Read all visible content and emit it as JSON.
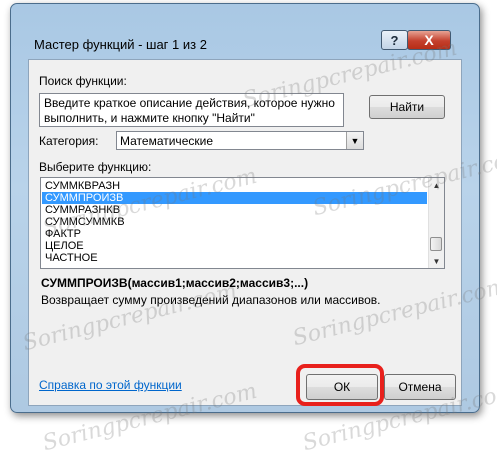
{
  "window": {
    "title": "Мастер функций - шаг 1 из 2",
    "help_button": "?",
    "close_button": "X"
  },
  "search": {
    "label": "Поиск функции:",
    "description_line1": "Введите краткое описание действия, которое нужно",
    "description_line2": "выполнить, и нажмите кнопку \"Найти\"",
    "find_button": "Найти"
  },
  "category": {
    "label": "Категория:",
    "selected": "Математические"
  },
  "functions": {
    "label": "Выберите функцию:",
    "items": [
      "СУММКВРАЗН",
      "СУММПРОИЗВ",
      "СУММРАЗНКВ",
      "СУММСУММКВ",
      "ФАКТР",
      "ЦЕЛОЕ",
      "ЧАСТНОЕ"
    ],
    "selected_index": 1
  },
  "details": {
    "syntax": "СУММПРОИЗВ(массив1;массив2;массив3;...)",
    "summary": "Возвращает сумму произведений диапазонов или массивов."
  },
  "footer": {
    "help_link": "Справка по этой функции",
    "ok_button": "ОК",
    "cancel_button": "Отмена"
  },
  "watermark": "Soringpcrepair.com",
  "colors": {
    "selection": "#3399ff",
    "highlight_ring": "#e8201c",
    "link": "#0066cc"
  }
}
